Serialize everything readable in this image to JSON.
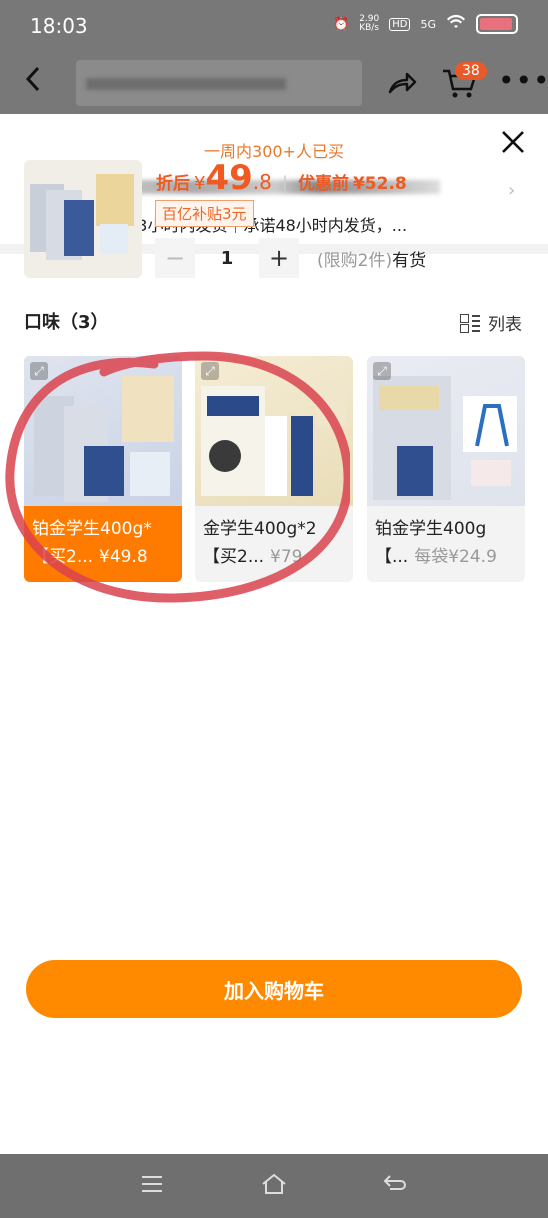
{
  "status": {
    "time": "18:03",
    "speed": "2.90\nKB/s",
    "hd": "HD",
    "net": "5G"
  },
  "header": {
    "cart_count": "38"
  },
  "sheet": {
    "sold_text": "一周内300+人已买",
    "shipping": "包邮 预计23小时内发货｜承诺48小时内发货，...",
    "price": {
      "after_label": "折后",
      "yen": "¥",
      "int": "49",
      "dec": ".8",
      "before_label": "优惠前",
      "before_price": "¥52.8"
    },
    "subsidy": "百亿补贴3元",
    "quantity": "1",
    "limit": "(限购2件)",
    "stock": "有货",
    "flavor_title": "口味（3）",
    "list_label": "列表",
    "options": [
      {
        "name": "铂金学生400g*",
        "sub": "【买2...",
        "price": "¥49.8",
        "selected": true
      },
      {
        "name": "金学生400g*2",
        "sub": "【买2...",
        "price": "¥79",
        "selected": false
      },
      {
        "name": "铂金学生400g",
        "sub": "【...",
        "price": "每袋¥24.9",
        "selected": false
      }
    ],
    "add_to_cart": "加入购物车"
  },
  "colors": {
    "accent": "#ff8a00",
    "price": "#ee5a22",
    "annotation": "#d9434f"
  }
}
